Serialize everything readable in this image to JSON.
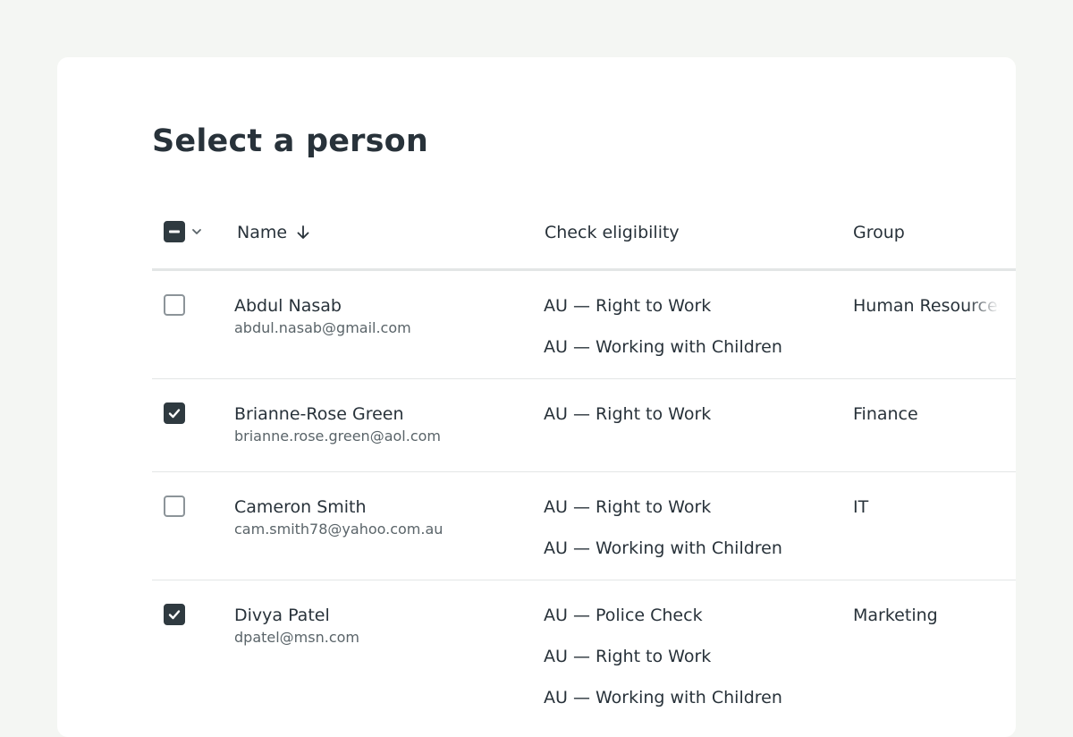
{
  "page": {
    "title": "Select a person"
  },
  "table": {
    "columns": {
      "name": "Name",
      "check": "Check eligibility",
      "group": "Group"
    },
    "select_all_state": "indeterminate",
    "rows": [
      {
        "name": "Abdul Nasab",
        "email": "abdul.nasab@gmail.com",
        "checks": [
          "AU — Right to Work",
          "AU — Working with Children"
        ],
        "group": "Human Resources",
        "selected": false
      },
      {
        "name": "Brianne-Rose Green",
        "email": "brianne.rose.green@aol.com",
        "checks": [
          "AU — Right to Work"
        ],
        "group": "Finance",
        "selected": true
      },
      {
        "name": "Cameron Smith",
        "email": "cam.smith78@yahoo.com.au",
        "checks": [
          "AU — Right to Work",
          "AU — Working with Children"
        ],
        "group": "IT",
        "selected": false
      },
      {
        "name": "Divya Patel",
        "email": "dpatel@msn.com",
        "checks": [
          "AU — Police Check",
          "AU — Right to Work",
          "AU — Working with Children"
        ],
        "group": "Marketing",
        "selected": true
      }
    ]
  },
  "icons": {
    "sort": "arrow-down-icon",
    "bulk_menu": "chevron-down-icon",
    "checked": "checkmark-icon",
    "indeterminate": "minus-icon"
  },
  "colors": {
    "background": "#f4f6f3",
    "card": "#ffffff",
    "checkbox_filled": "#2f3a40",
    "checkbox_border": "#8c9499",
    "divider": "#e3e6e6"
  }
}
